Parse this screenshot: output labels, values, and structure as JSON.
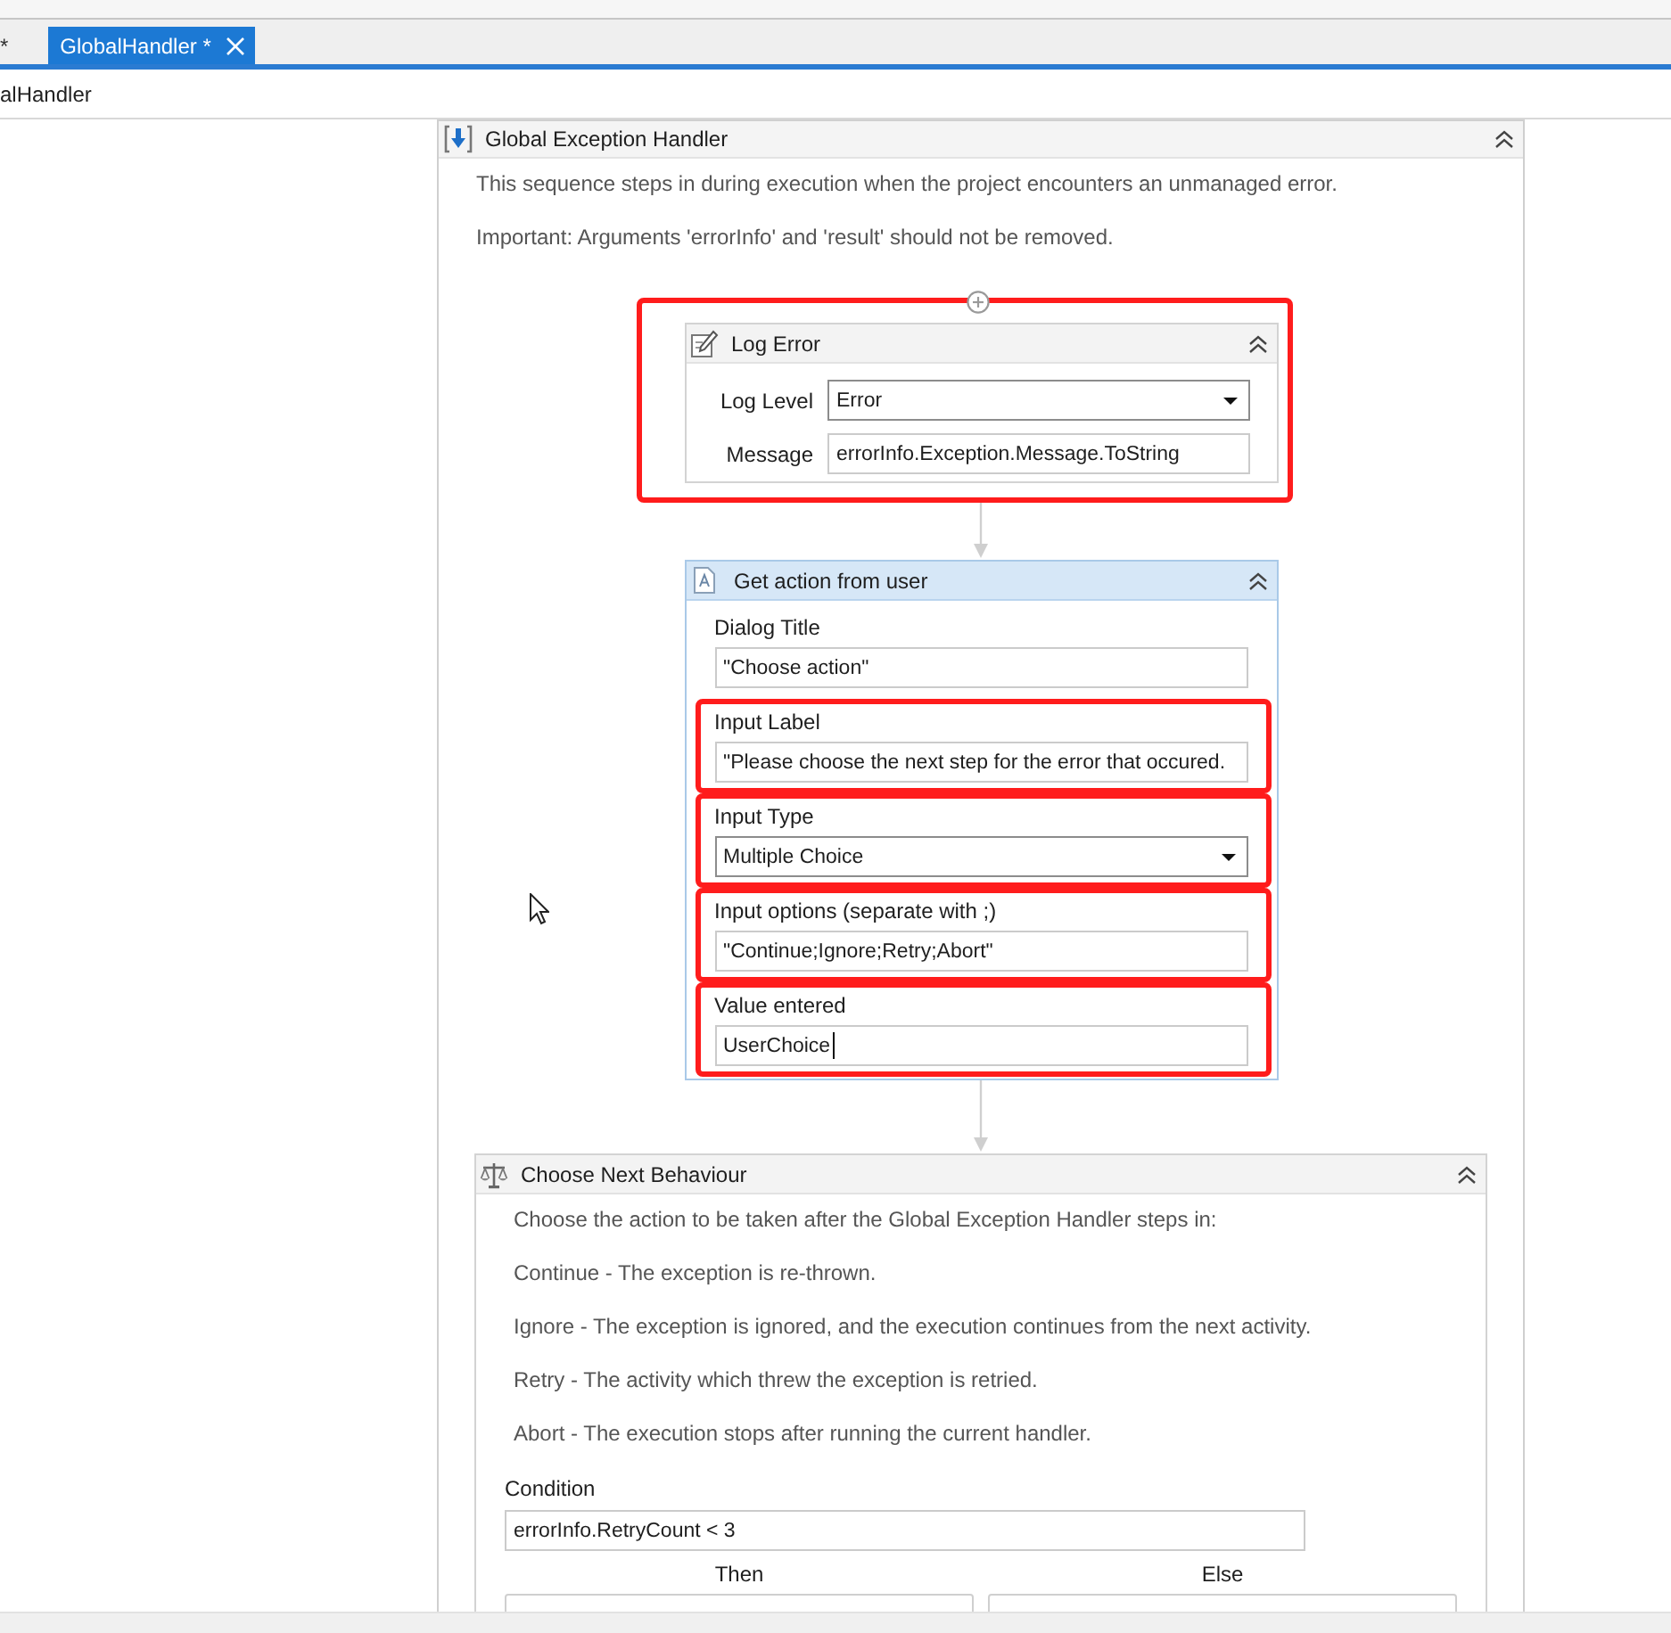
{
  "tabs": [
    {
      "label": "*",
      "selected": false,
      "closable": false
    },
    {
      "label": "GlobalHandler *",
      "selected": true,
      "closable": true
    }
  ],
  "breadcrumb": "alHandler",
  "sequence": {
    "title": "Global Exception Handler",
    "description": [
      "This sequence steps in during execution when the project encounters an unmanaged error.",
      "Important: Arguments 'errorInfo' and 'result' should not be removed."
    ]
  },
  "log_error": {
    "title": "Log Error",
    "selected": false,
    "highlighted": true,
    "fields": [
      {
        "label": "Log Level",
        "kind": "dropdown",
        "value": "Error"
      },
      {
        "label": "Message",
        "kind": "text",
        "value": "errorInfo.Exception.Message.ToString"
      }
    ]
  },
  "get_action": {
    "title": "Get action from user",
    "selected": true,
    "fields": [
      {
        "label": "Dialog Title",
        "kind": "text",
        "value": "\"Choose action\"",
        "highlighted": false,
        "focused": false
      },
      {
        "label": "Input Label",
        "kind": "text",
        "value": "\"Please choose the next step for the error that occured.",
        "highlighted": true,
        "focused": false
      },
      {
        "label": "Input Type",
        "kind": "dropdown",
        "value": "Multiple Choice",
        "highlighted": true,
        "focused": false
      },
      {
        "label": "Input options (separate with ;)",
        "kind": "text",
        "value": "\"Continue;Ignore;Retry;Abort\"",
        "highlighted": true,
        "focused": false
      },
      {
        "label": "Value entered",
        "kind": "text",
        "value": "UserChoice",
        "highlighted": true,
        "focused": true
      }
    ]
  },
  "choose_next": {
    "title": "Choose Next Behaviour",
    "selected": false,
    "description": [
      "Choose the action to be taken after the Global Exception Handler steps in:",
      "Continue - The exception is re-thrown.",
      "Ignore - The exception is ignored, and the execution continues from the next activity.",
      "Retry - The activity which threw the exception is retried.",
      "Abort - The execution stops after running the current handler."
    ],
    "condition": {
      "label": "Condition",
      "value": "errorInfo.RetryCount < 3"
    },
    "branches": [
      "Then",
      "Else"
    ]
  }
}
